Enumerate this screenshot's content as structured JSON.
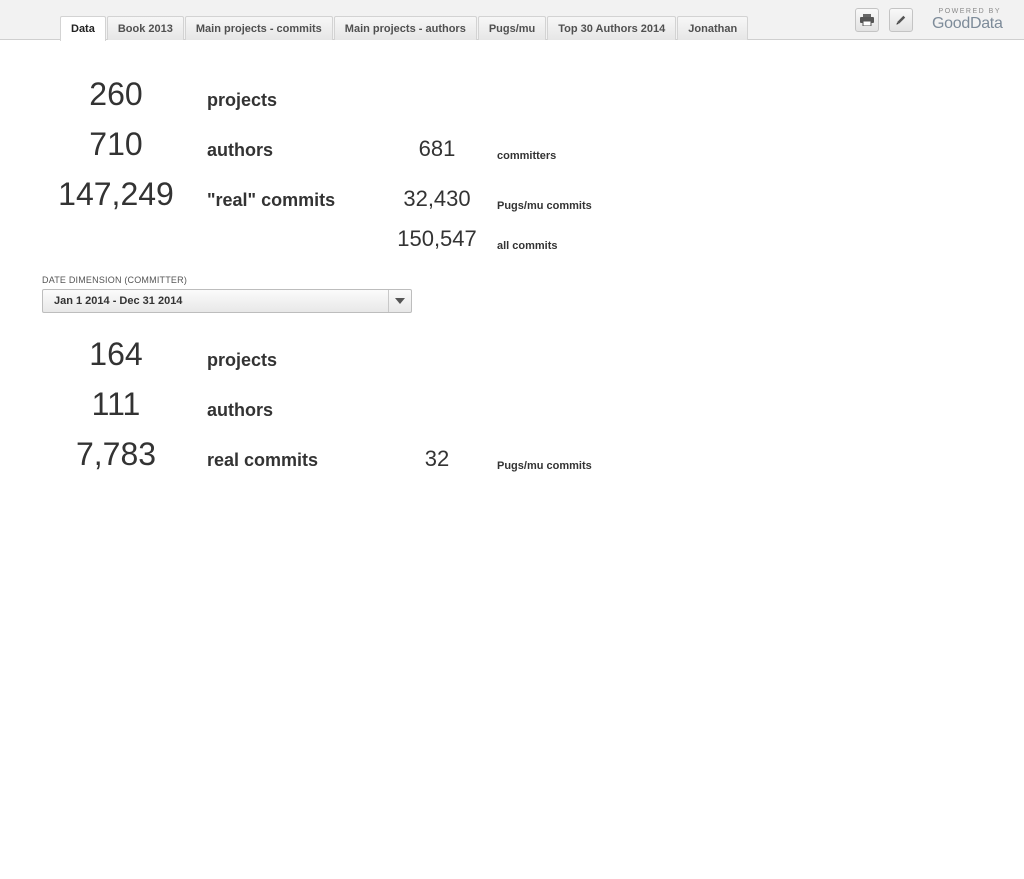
{
  "tabs": [
    {
      "label": "Data",
      "active": true
    },
    {
      "label": "Book 2013"
    },
    {
      "label": "Main projects - commits"
    },
    {
      "label": "Main projects - authors"
    },
    {
      "label": "Pugs/mu"
    },
    {
      "label": "Top 30 Authors 2014"
    },
    {
      "label": "Jonathan"
    }
  ],
  "toolbar": {
    "print_icon": "printer-icon",
    "edit_icon": "pencil-icon"
  },
  "brand": {
    "powered_by": "POWERED BY",
    "name": "GoodData"
  },
  "overall": {
    "projects": {
      "value": "260",
      "label": "projects"
    },
    "authors": {
      "value": "710",
      "label": "authors"
    },
    "committers": {
      "value": "681",
      "label": "committers"
    },
    "real_commits": {
      "value": "147,249",
      "label": "\"real\" commits"
    },
    "pugs_commits": {
      "value": "32,430",
      "label": "Pugs/mu commits"
    },
    "all_commits": {
      "value": "150,547",
      "label": "all commits"
    }
  },
  "filter": {
    "label": "DATE DIMENSION (COMMITTER)",
    "value": "Jan 1 2014 - Dec 31 2014",
    "caret_icon": "chevron-down-icon"
  },
  "filtered": {
    "projects": {
      "value": "164",
      "label": "projects"
    },
    "authors": {
      "value": "111",
      "label": "authors"
    },
    "real_commits": {
      "value": "7,783",
      "label": "real commits"
    },
    "pugs_commits": {
      "value": "32",
      "label": "Pugs/mu commits"
    }
  },
  "colors": {
    "text": "#333333",
    "topbar": "#f2f2f2",
    "brand": "#7d8b99"
  }
}
